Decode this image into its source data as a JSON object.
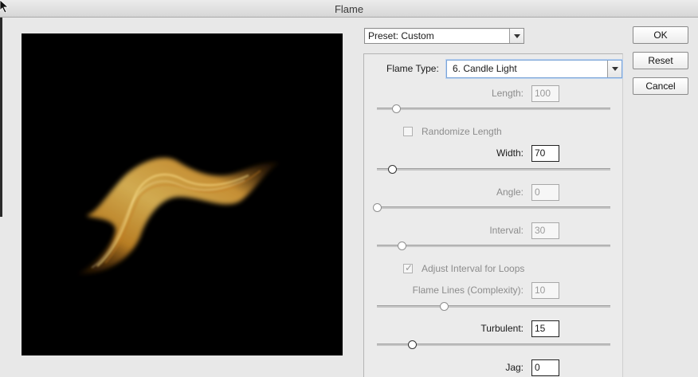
{
  "window": {
    "title": "Flame"
  },
  "preset": {
    "value": "Preset: Custom"
  },
  "buttons": {
    "ok": "OK",
    "reset": "Reset",
    "cancel": "Cancel"
  },
  "flame_type": {
    "label": "Flame Type:",
    "value": "6. Candle Light"
  },
  "controls": {
    "length": {
      "label": "Length:",
      "value": "100",
      "slider": 0.07
    },
    "randomize_length": {
      "label": "Randomize Length",
      "checked": false
    },
    "width": {
      "label": "Width:",
      "value": "70",
      "slider": 0.06
    },
    "angle": {
      "label": "Angle:",
      "value": "0",
      "slider": 0.0
    },
    "interval": {
      "label": "Interval:",
      "value": "30",
      "slider": 0.1
    },
    "adjust_interval": {
      "label": "Adjust Interval for Loops",
      "checked": true
    },
    "flame_lines": {
      "label": "Flame Lines (Complexity):",
      "value": "10",
      "slider": 0.28
    },
    "turbulent": {
      "label": "Turbulent:",
      "value": "15",
      "slider": 0.15
    },
    "jag": {
      "label": "Jag:",
      "value": "0"
    }
  },
  "colors": {
    "flame_light": "#f6c95f",
    "flame_mid": "#d9942a",
    "flame_dark": "#8a4a10",
    "focus": "#7da5d8"
  }
}
